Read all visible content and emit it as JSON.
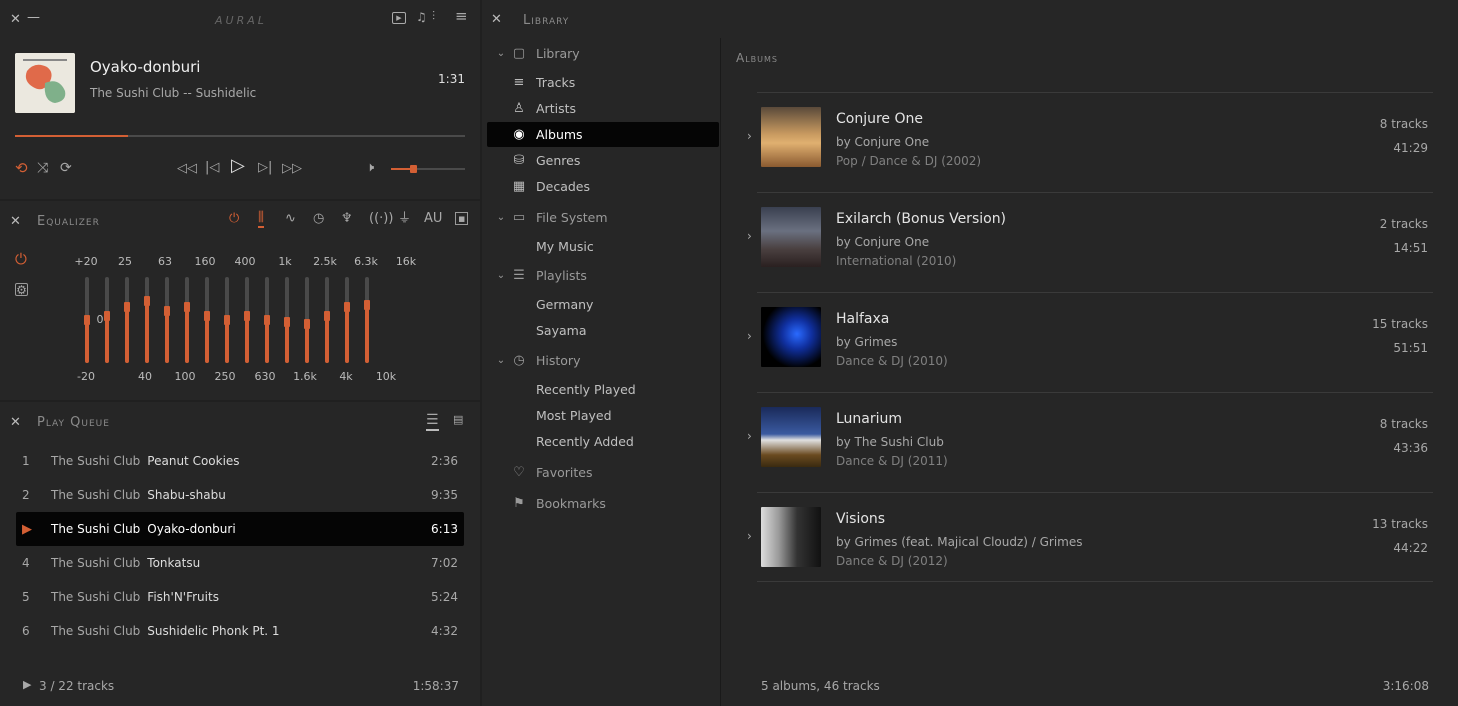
{
  "player": {
    "app_logo": "AURAL",
    "track_title": "Oyako-donburi",
    "track_subtitle": "The Sushi Club -- Sushidelic",
    "elapsed": "1:31",
    "progress": 0.25,
    "volume": 0.3,
    "accent": "#d35f34"
  },
  "equalizer": {
    "title": "Equalizer",
    "tab_au": "AU",
    "top_labels": [
      "+20",
      "25",
      "63",
      "160",
      "400",
      "1k",
      "2.5k",
      "6.3k",
      "16k"
    ],
    "bottom_labels": [
      "-20",
      "40",
      "100",
      "250",
      "630",
      "1.6k",
      "4k",
      "10k"
    ],
    "zero_label": "0",
    "bands": [
      0.5,
      0.55,
      0.65,
      0.72,
      0.6,
      0.65,
      0.55,
      0.5,
      0.55,
      0.5,
      0.48,
      0.45,
      0.55,
      0.65,
      0.68
    ]
  },
  "queue": {
    "title": "Play Queue",
    "rows": [
      {
        "num": "1",
        "artist": "The Sushi Club",
        "title": "Peanut Cookies",
        "dur": "2:36"
      },
      {
        "num": "2",
        "artist": "The Sushi Club",
        "title": "Shabu-shabu",
        "dur": "9:35"
      },
      {
        "num": "",
        "artist": "The Sushi Club",
        "title": "Oyako-donburi",
        "dur": "6:13"
      },
      {
        "num": "4",
        "artist": "The Sushi Club",
        "title": "Tonkatsu",
        "dur": "7:02"
      },
      {
        "num": "5",
        "artist": "The Sushi Club",
        "title": "Fish'N'Fruits",
        "dur": "5:24"
      },
      {
        "num": "6",
        "artist": "The Sushi Club",
        "title": "Sushidelic Phonk Pt. 1",
        "dur": "4:32"
      }
    ],
    "footer_count": "3 / 22 tracks",
    "footer_total": "1:58:37"
  },
  "library": {
    "title": "Library",
    "section_title": "Albums",
    "tree": [
      {
        "label": "Library",
        "level": 0
      },
      {
        "label": "Tracks",
        "level": 1
      },
      {
        "label": "Artists",
        "level": 1
      },
      {
        "label": "Albums",
        "level": 1
      },
      {
        "label": "Genres",
        "level": 1
      },
      {
        "label": "Decades",
        "level": 1
      },
      {
        "label": "File System",
        "level": 0
      },
      {
        "label": "My Music",
        "level": 1
      },
      {
        "label": "Playlists",
        "level": 0
      },
      {
        "label": "Germany",
        "level": 1
      },
      {
        "label": "Sayama",
        "level": 1
      },
      {
        "label": "History",
        "level": 0
      },
      {
        "label": "Recently Played",
        "level": 1
      },
      {
        "label": "Most Played",
        "level": 1
      },
      {
        "label": "Recently Added",
        "level": 1
      },
      {
        "label": "Favorites",
        "level": 0
      },
      {
        "label": "Bookmarks",
        "level": 0
      }
    ],
    "albums": [
      {
        "title": "Conjure One",
        "by": "by Conjure One",
        "genre": "Pop / Dance & DJ  (2002)",
        "tracks": "8 tracks",
        "dur": "41:29"
      },
      {
        "title": "Exilarch (Bonus Version)",
        "by": "by Conjure One",
        "genre": "International  (2010)",
        "tracks": "2 tracks",
        "dur": "14:51"
      },
      {
        "title": "Halfaxa",
        "by": "by Grimes",
        "genre": "Dance & DJ  (2010)",
        "tracks": "15 tracks",
        "dur": "51:51"
      },
      {
        "title": "Lunarium",
        "by": "by The Sushi Club",
        "genre": "Dance & DJ  (2011)",
        "tracks": "8 tracks",
        "dur": "43:36"
      },
      {
        "title": "Visions",
        "by": "by Grimes (feat. Majical Cloudz) / Grimes",
        "genre": "Dance & DJ  (2012)",
        "tracks": "13 tracks",
        "dur": "44:22"
      }
    ],
    "footer_count": "5 albums, 46 tracks",
    "footer_total": "3:16:08"
  }
}
